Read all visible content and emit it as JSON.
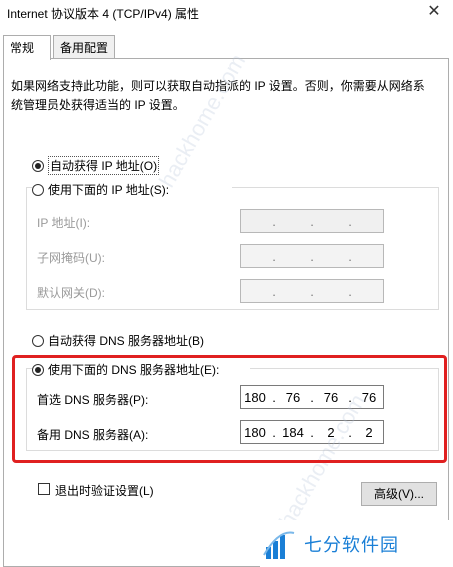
{
  "window": {
    "title": "Internet 协议版本 4 (TCP/IPv4) 属性",
    "close_glyph": "✕"
  },
  "tabs": [
    {
      "label": "常规"
    },
    {
      "label": "备用配置"
    }
  ],
  "description": "如果网络支持此功能，则可以获取自动指派的 IP 设置。否则，你需要从网络系统管理员处获得适当的 IP 设置。",
  "ip": {
    "auto_label": "自动获得 IP 地址(O)",
    "manual_label": "使用下面的 IP 地址(S):",
    "address_label": "IP 地址(I):",
    "subnet_label": "子网掩码(U):",
    "gateway_label": "默认网关(D):"
  },
  "dns": {
    "auto_label": "自动获得 DNS 服务器地址(B)",
    "manual_label": "使用下面的 DNS 服务器地址(E):",
    "preferred_label": "首选 DNS 服务器(P):",
    "alternate_label": "备用 DNS 服务器(A):",
    "preferred_value": [
      "180",
      "76",
      "76",
      "76"
    ],
    "alternate_value": [
      "180",
      "184",
      "2",
      "2"
    ]
  },
  "validate_label": "退出时验证设置(L)",
  "advanced_button": "高级(V)...",
  "dot": ".",
  "watermark": {
    "text": "七分软件园",
    "faint_text": "hackhome.com"
  },
  "colors": {
    "highlight": "#e02020",
    "watermark_blue": "#1a7fd6"
  }
}
